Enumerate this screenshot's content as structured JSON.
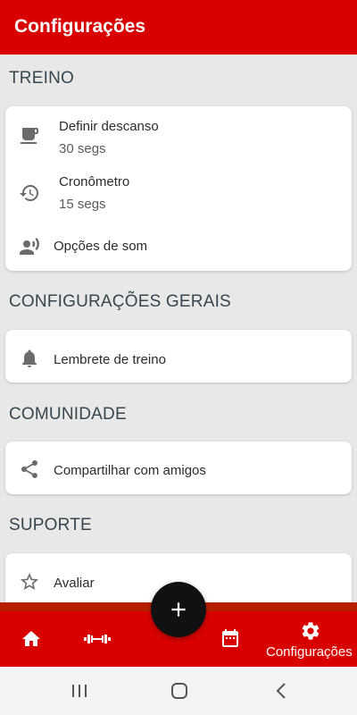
{
  "appbar": {
    "title": "Configurações"
  },
  "sections": {
    "treino": {
      "title": "TREINO",
      "items": [
        {
          "label": "Definir descanso",
          "value": "30 segs",
          "icon": "coffee-cup-icon"
        },
        {
          "label": "Cronômetro",
          "value": "15 segs",
          "icon": "history-icon"
        },
        {
          "label": "Opções de som",
          "icon": "voice-icon"
        }
      ]
    },
    "gerais": {
      "title": "CONFIGURAÇÕES GERAIS",
      "items": [
        {
          "label": "Lembrete de treino",
          "icon": "bell-icon"
        }
      ]
    },
    "comunidade": {
      "title": "COMUNIDADE",
      "items": [
        {
          "label": "Compartilhar com amigos",
          "icon": "share-icon"
        }
      ]
    },
    "suporte": {
      "title": "SUPORTE",
      "items": [
        {
          "label": "Avaliar",
          "icon": "star-icon"
        }
      ]
    }
  },
  "bottom_nav": {
    "items": [
      {
        "icon": "home-icon"
      },
      {
        "icon": "dumbbell-icon"
      },
      {
        "icon": "calendar-icon"
      },
      {
        "icon": "gear-icon",
        "label": "Configurações",
        "active": true
      }
    ]
  },
  "fab": {
    "icon": "plus-icon"
  },
  "colors": {
    "primary": "#d90000",
    "fab": "#111111",
    "background": "#e8e8e8"
  }
}
